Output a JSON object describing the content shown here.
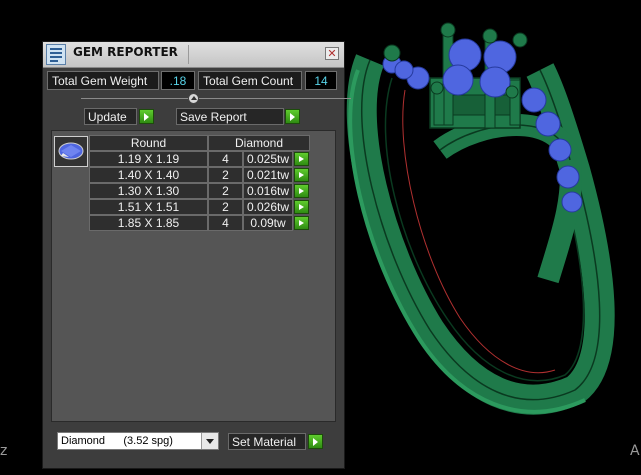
{
  "panel": {
    "title": "GEM REPORTER",
    "close_glyph": "✕",
    "icon": "gem-reporter-app-icon",
    "total_weight_label": "Total Gem Weight",
    "total_weight_value": ".18",
    "total_count_label": "Total Gem Count",
    "total_count_value": "14",
    "update_label": "Update",
    "save_report_label": "Save Report",
    "table_headers": [
      "Round",
      "Diamond"
    ],
    "rows": [
      {
        "size": "1.19 X 1.19",
        "count": "4",
        "weight": "0.025tw"
      },
      {
        "size": "1.40 X 1.40",
        "count": "2",
        "weight": "0.021tw"
      },
      {
        "size": "1.30 X 1.30",
        "count": "2",
        "weight": "0.016tw"
      },
      {
        "size": "1.51 X 1.51",
        "count": "2",
        "weight": "0.026tw"
      },
      {
        "size": "1.85 X 1.85",
        "count": "4",
        "weight": "0.09tw"
      }
    ],
    "material_selected": "Diamond      (3.52 spg)",
    "set_material_label": "Set Material"
  },
  "viewport": {
    "model": "ring-3d-model",
    "left_edge_char": "z",
    "right_edge_char": "A"
  },
  "colors": {
    "metal": "#1f7a4a",
    "gem": "#4f66e0",
    "value_text": "#57d3e8",
    "go_button": "#3fae1c"
  }
}
